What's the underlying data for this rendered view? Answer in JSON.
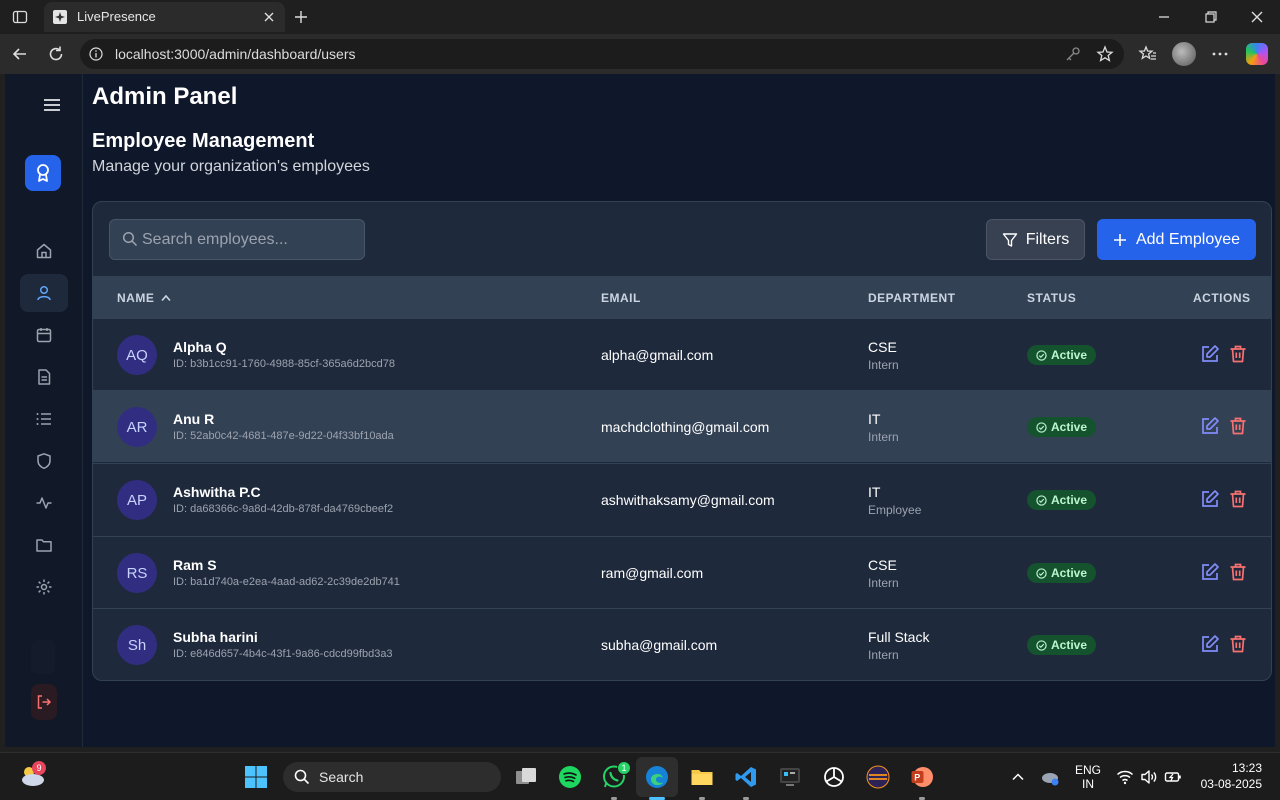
{
  "browser": {
    "tab_title": "LivePresence",
    "url": "localhost:3000/admin/dashboard/users"
  },
  "app": {
    "panel_title": "Admin Panel",
    "section_title": "Employee Management",
    "section_subtitle": "Manage your organization's employees",
    "search_placeholder": "Search employees...",
    "filters_label": "Filters",
    "add_label": "Add Employee",
    "headers": {
      "name": "NAME",
      "email": "EMAIL",
      "department": "DEPARTMENT",
      "status": "STATUS",
      "actions": "ACTIONS"
    },
    "sort": "name-ascending",
    "employees": [
      {
        "initials": "AQ",
        "name": "Alpha Q",
        "id": "ID: b3b1cc91-1760-4988-85cf-365a6d2bcd78",
        "email": "alpha@gmail.com",
        "department": "CSE",
        "role": "Intern",
        "status": "Active"
      },
      {
        "initials": "AR",
        "name": "Anu R",
        "id": "ID: 52ab0c42-4681-487e-9d22-04f33bf10ada",
        "email": "machdclothing@gmail.com",
        "department": "IT",
        "role": "Intern",
        "status": "Active"
      },
      {
        "initials": "AP",
        "name": "Ashwitha P.C",
        "id": "ID: da68366c-9a8d-42db-878f-da4769cbeef2",
        "email": "ashwithaksamy@gmail.com",
        "department": "IT",
        "role": "Employee",
        "status": "Active"
      },
      {
        "initials": "RS",
        "name": "Ram S",
        "id": "ID: ba1d740a-e2ea-4aad-ad62-2c39de2db741",
        "email": "ram@gmail.com",
        "department": "CSE",
        "role": "Intern",
        "status": "Active"
      },
      {
        "initials": "Sh",
        "name": "Subha harini",
        "id": "ID: e846d657-4b4c-43f1-9a86-cdcd99fbd3a3",
        "email": "subha@gmail.com",
        "department": "Full Stack",
        "role": "Intern",
        "status": "Active"
      }
    ],
    "colors": {
      "accent": "#2563eb",
      "background": "#0f172a",
      "card": "#1e293b",
      "status_active_bg": "#14532d",
      "status_active_text": "#bbf7d0",
      "edit_icon": "#818cf8",
      "delete_icon": "#f87171"
    }
  },
  "taskbar": {
    "search_label": "Search",
    "weather_badge": "9",
    "whatsapp_badge": "1",
    "lang_line1": "ENG",
    "lang_line2": "IN",
    "time": "13:23",
    "date": "03-08-2025"
  }
}
